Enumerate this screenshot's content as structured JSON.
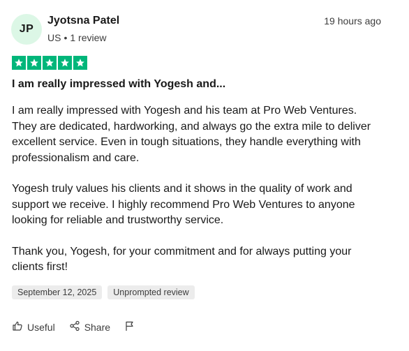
{
  "reviewer": {
    "initials": "JP",
    "name": "Jyotsna Patel",
    "country": "US",
    "separator": "•",
    "review_count": "1 review",
    "avatar_bg": "#dcf7e6"
  },
  "review": {
    "time_ago": "19 hours ago",
    "rating": 5,
    "star_color": "#00b67a",
    "title": "I am really impressed with Yogesh and...",
    "paragraphs": [
      "I am really impressed with Yogesh and his team at Pro Web Ventures. They are dedicated, hardworking, and always go the extra mile to deliver excellent service. Even in tough situations, they handle everything with professionalism and care.",
      "Yogesh truly values his clients and it shows in the quality of work and support we receive. I highly recommend Pro Web Ventures to anyone looking for reliable and trustworthy service.",
      "Thank you, Yogesh, for your commitment and for always putting your clients first!"
    ],
    "date_tag": "September 12, 2025",
    "type_tag": "Unprompted review"
  },
  "actions": {
    "useful_label": "Useful",
    "share_label": "Share",
    "icons": [
      "thumbs-up-icon",
      "share-icon",
      "flag-icon"
    ]
  }
}
